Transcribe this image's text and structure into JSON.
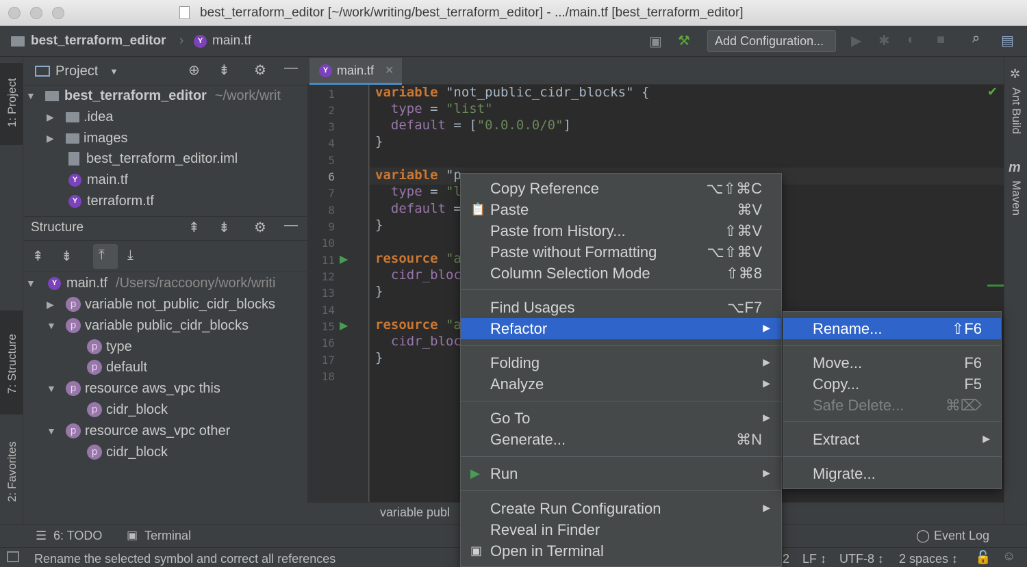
{
  "window": {
    "title": "best_terraform_editor [~/work/writing/best_terraform_editor] - .../main.tf [best_terraform_editor]"
  },
  "navbar": {
    "project": "best_terraform_editor",
    "file": "main.tf",
    "add_configuration": "Add Configuration..."
  },
  "left_stripe": {
    "project_tab": "1: Project",
    "structure_tab": "7: Structure",
    "favorites_tab": "2: Favorites"
  },
  "right_stripe": {
    "ant_build": "Ant Build",
    "maven": "Maven"
  },
  "project_panel": {
    "title": "Project",
    "root": {
      "name": "best_terraform_editor",
      "path": "~/work/writ"
    },
    "items": [
      ".idea",
      "images",
      "best_terraform_editor.iml",
      "main.tf",
      "terraform.tf"
    ]
  },
  "structure_panel": {
    "title": "Structure",
    "root": {
      "name": "main.tf",
      "path": "/Users/raccoony/work/writi"
    },
    "items": [
      "variable not_public_cidr_blocks",
      "variable public_cidr_blocks",
      "type",
      "default",
      "resource aws_vpc this",
      "cidr_block",
      "resource aws_vpc other",
      "cidr_block"
    ]
  },
  "editor": {
    "tab": "main.tf",
    "line_numbers": [
      "1",
      "2",
      "3",
      "4",
      "5",
      "6",
      "7",
      "8",
      "9",
      "10",
      "11",
      "12",
      "13",
      "14",
      "15",
      "16",
      "17",
      "18"
    ],
    "lines": {
      "l1_kw": "variable",
      "l1_str": "\"not_public_cidr_blocks\"",
      "l1_rest": " {",
      "l2_prop": "  type",
      "l2_eq": " = ",
      "l2_str": "\"list\"",
      "l3_prop": "  default",
      "l3_eq": " = [",
      "l3_str": "\"0.0.0.0/0\"",
      "l3_rest": "]",
      "l4": "}",
      "l6_kw": "variable",
      "l6_str": " \"p",
      "l7_prop": "  type",
      "l7_eq": " = ",
      "l7_str": "\"l",
      "l8_prop": "  default",
      "l8_eq": " =",
      "l9": "}",
      "l11_kw": "resource",
      "l11_str": " \"a",
      "l12_prop": "  cidr_bloc",
      "l13": "}",
      "l15_kw": "resource",
      "l15_str": " \"a",
      "l16_prop": "  cidr_bloc",
      "l17": "}"
    },
    "breadcrumb": "variable publ"
  },
  "context_menu": {
    "items": [
      {
        "label": "Copy Reference",
        "shortcut": "⌥⇧⌘C"
      },
      {
        "label": "Paste",
        "shortcut": "⌘V"
      },
      {
        "label": "Paste from History...",
        "shortcut": "⇧⌘V"
      },
      {
        "label": "Paste without Formatting",
        "shortcut": "⌥⇧⌘V"
      },
      {
        "label": "Column Selection Mode",
        "shortcut": "⇧⌘8"
      },
      {
        "label": "Find Usages",
        "shortcut": "⌥F7"
      },
      {
        "label": "Refactor",
        "shortcut": ""
      },
      {
        "label": "Folding",
        "shortcut": ""
      },
      {
        "label": "Analyze",
        "shortcut": ""
      },
      {
        "label": "Go To",
        "shortcut": ""
      },
      {
        "label": "Generate...",
        "shortcut": "⌘N"
      },
      {
        "label": "Run",
        "shortcut": ""
      },
      {
        "label": "Create Run Configuration",
        "shortcut": ""
      },
      {
        "label": "Reveal in Finder",
        "shortcut": ""
      },
      {
        "label": "Open in Terminal",
        "shortcut": ""
      }
    ]
  },
  "refactor_submenu": {
    "items": [
      {
        "label": "Rename...",
        "shortcut": "⇧F6"
      },
      {
        "label": "Move...",
        "shortcut": "F6"
      },
      {
        "label": "Copy...",
        "shortcut": "F5"
      },
      {
        "label": "Safe Delete...",
        "shortcut": "⌘⌦"
      },
      {
        "label": "Extract",
        "shortcut": ""
      },
      {
        "label": "Migrate...",
        "shortcut": ""
      }
    ]
  },
  "tool_windows": {
    "todo": "6: TODO",
    "terminal": "Terminal",
    "event_log": "Event Log"
  },
  "status_bar": {
    "message": "Rename the selected symbol and correct all references",
    "position": "2",
    "line_sep": "LF ↕",
    "encoding": "UTF-8 ↕",
    "indent": "2 spaces ↕"
  },
  "colors": {
    "accent": "#2f65ca",
    "keyword": "#cc7832",
    "string": "#6a8759",
    "property": "#9876aa",
    "terraform_purple": "#7b42bc"
  }
}
